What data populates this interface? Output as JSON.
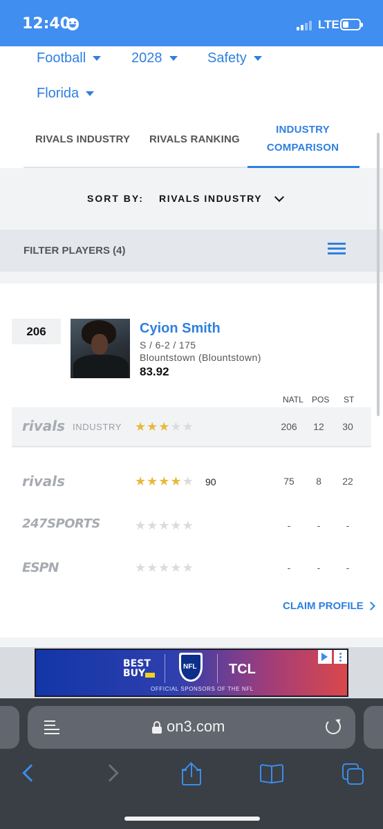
{
  "status_bar": {
    "time": "12:40",
    "network": "LTE",
    "icons": [
      "face-icon",
      "signal-icon",
      "battery-icon"
    ]
  },
  "filters": [
    {
      "label": "Football"
    },
    {
      "label": "2028"
    },
    {
      "label": "Safety"
    },
    {
      "label": "Florida"
    }
  ],
  "tabs": [
    {
      "label": "RIVALS INDUSTRY",
      "active": false
    },
    {
      "label": "RIVALS RANKING",
      "active": false
    },
    {
      "label_line1": "INDUSTRY",
      "label_line2": "COMPARISON",
      "active": true
    }
  ],
  "sort": {
    "label": "SORT BY:",
    "value": "RIVALS INDUSTRY"
  },
  "filter_players": {
    "label": "FILTER PLAYERS (4)"
  },
  "player": {
    "rank": "206",
    "name": "Cyion Smith",
    "position_line": "S / 6-2 / 175",
    "school": "Blountstown (Blountstown)",
    "score": "83.92"
  },
  "columns": [
    "NATL",
    "POS",
    "ST"
  ],
  "ratings": [
    {
      "service": "rivals",
      "sub": "INDUSTRY",
      "stars": 3,
      "rating": "",
      "natl": "206",
      "pos": "12",
      "st": "30"
    },
    {
      "service": "rivals",
      "sub": "",
      "stars": 4,
      "rating": "90",
      "natl": "75",
      "pos": "8",
      "st": "22"
    },
    {
      "service": "247SPORTS",
      "sub": "",
      "stars": 0,
      "rating": "",
      "natl": "-",
      "pos": "-",
      "st": "-"
    },
    {
      "service": "ESPN",
      "sub": "",
      "stars": 0,
      "rating": "",
      "natl": "-",
      "pos": "-",
      "st": "-"
    }
  ],
  "claim_profile": "CLAIM PROFILE",
  "ad": {
    "brand1_line1": "BEST",
    "brand1_line2": "BUY",
    "brand2": "NFL",
    "brand3": "TCL",
    "tagline": "OFFICIAL SPONSORS OF THE NFL"
  },
  "browser": {
    "url": "on3.com"
  },
  "colors": {
    "accent": "#2f7fe0",
    "status_bar": "#3f8ef0",
    "star_on": "#e8b93a",
    "star_off": "#d9dcdf"
  }
}
